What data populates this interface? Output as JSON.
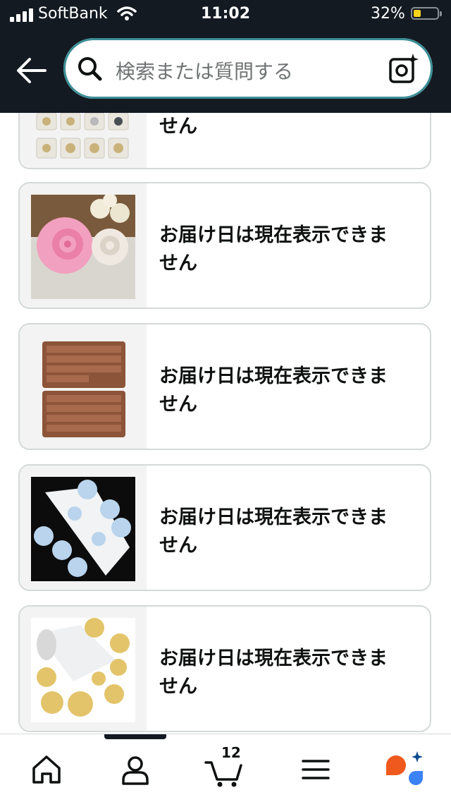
{
  "status_bar": {
    "carrier": "SoftBank",
    "time": "11:02",
    "battery_percent": "32%",
    "battery_level": 0.32,
    "icons": [
      "signal-icon",
      "wifi-icon",
      "battery-icon"
    ]
  },
  "header": {
    "search_placeholder": "検索または質問する",
    "icons": [
      "back-arrow-icon",
      "search-icon",
      "camera-icon"
    ]
  },
  "products": [
    {
      "message_line1": "",
      "message_line2": "せん",
      "image": "glitter-jars"
    },
    {
      "message_line1": "お届け日は現在表示できま",
      "message_line2": "せん",
      "image": "rose-silicone-mold"
    },
    {
      "message_line1": "お届け日は現在表示できま",
      "message_line2": "せん",
      "image": "alphabet-chocolate-mold"
    },
    {
      "message_line1": "お届け日は現在表示できま",
      "message_line2": "せん",
      "image": "silver-snowflake-stickers"
    },
    {
      "message_line1": "お届け日は現在表示できま",
      "message_line2": "せん",
      "image": "gold-snowflake-stickers"
    }
  ],
  "bottom_nav": {
    "cart_count": "12",
    "items": [
      "home-icon",
      "account-icon",
      "cart-icon",
      "menu-icon",
      "rufus-assistant-icon"
    ],
    "active_index": 1
  },
  "colors": {
    "header_bg": "#131a22",
    "search_border": "#3b8f96",
    "card_border": "#d5d9d9",
    "battery_fill": "#f7d21d",
    "assistant_orange": "#f0591e",
    "assistant_blue": "#3b82f6"
  }
}
